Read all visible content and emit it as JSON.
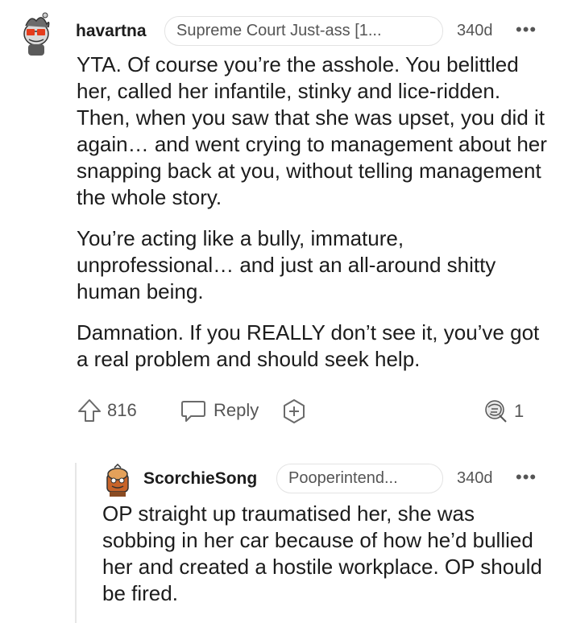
{
  "comments": [
    {
      "username": "havartna",
      "flair": "Supreme Court Just-ass [1...",
      "age": "340d",
      "more_label": "•••",
      "paragraphs": [
        "YTA. Of course you’re the asshole. You belittled her, called her infantile, stinky and lice-ridden. Then, when you saw that she was upset, you did it again… and went crying to management about her snapping back at you, without telling management the whole story.",
        "You’re acting like a bully, immature, unprofessional… and just an all-around shitty human being.",
        "Damnation. If you REALLY don’t see it, you’ve got a real problem and should seek help."
      ],
      "actions": {
        "upvote_count": "816",
        "reply_label": "Reply",
        "award_count": "1"
      }
    },
    {
      "username": "ScorchieSong",
      "flair": "Pooperintend...",
      "age": "340d",
      "more_label": "•••",
      "paragraphs": [
        "OP straight up traumatised her, she was sobbing in her car because of how he’d bullied her and created a hostile workplace. OP should be fired."
      ]
    }
  ],
  "colors": {
    "text": "#1c1c1c",
    "meta": "#555555",
    "flair_border": "#e3e3e3",
    "thread_line": "#e6e6e6"
  }
}
